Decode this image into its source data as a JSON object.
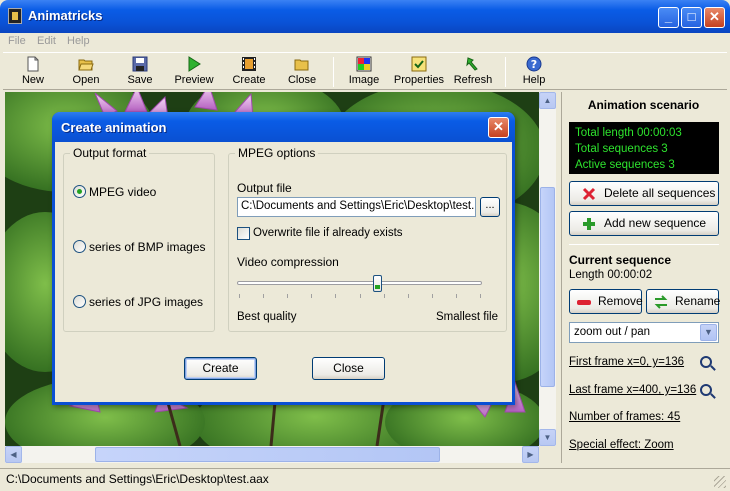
{
  "window": {
    "title": "Animatricks",
    "min": "_",
    "max": "□",
    "close": "✕"
  },
  "menu": [
    "File",
    "Edit",
    "Help"
  ],
  "toolbar": [
    {
      "label": "New",
      "icon": "new-icon"
    },
    {
      "label": "Open",
      "icon": "open-icon"
    },
    {
      "label": "Save",
      "icon": "save-icon"
    },
    {
      "label": "Preview",
      "icon": "preview-icon"
    },
    {
      "label": "Create",
      "icon": "create-icon"
    },
    {
      "label": "Close",
      "icon": "close-icon"
    },
    {
      "label": "Image",
      "icon": "image-icon"
    },
    {
      "label": "Properties",
      "icon": "properties-icon"
    },
    {
      "label": "Refresh",
      "icon": "refresh-icon"
    },
    {
      "label": "Help",
      "icon": "help-icon"
    }
  ],
  "panel": {
    "title": "Animation scenario",
    "console": [
      "Total length 00:00:03",
      "Total sequences 3",
      "Active sequences 3"
    ],
    "delete_all": "Delete all sequences",
    "add_new": "Add new sequence",
    "current_title": "Current sequence",
    "length": "Length 00:00:02",
    "remove": "Remove",
    "rename": "Rename",
    "effect_select": "zoom out / pan",
    "first_frame": "First frame x=0, y=136",
    "last_frame": "Last frame x=400, y=136",
    "num_frames": "Number of frames: 45",
    "special_effect": "Special effect: Zoom"
  },
  "status": "C:\\Documents and Settings\\Eric\\Desktop\\test.aax",
  "dialog": {
    "title": "Create animation",
    "output_format_label": "Output format",
    "formats": [
      {
        "label": "MPEG video",
        "selected": true
      },
      {
        "label": "series of BMP images",
        "selected": false
      },
      {
        "label": "series of JPG images",
        "selected": false
      }
    ],
    "mpeg_options_label": "MPEG options",
    "output_file_label": "Output file",
    "output_file_value": "C:\\Documents and Settings\\Eric\\Desktop\\test.m",
    "browse": "...",
    "overwrite_label": "Overwrite file if already exists",
    "overwrite_checked": false,
    "compression_label": "Video compression",
    "compression_level": 0.57,
    "best_quality": "Best quality",
    "smallest_file": "Smallest file",
    "create": "Create",
    "close": "Close"
  },
  "colors": {
    "accent": "#0a5ce6",
    "console_text": "#2ee32e"
  }
}
